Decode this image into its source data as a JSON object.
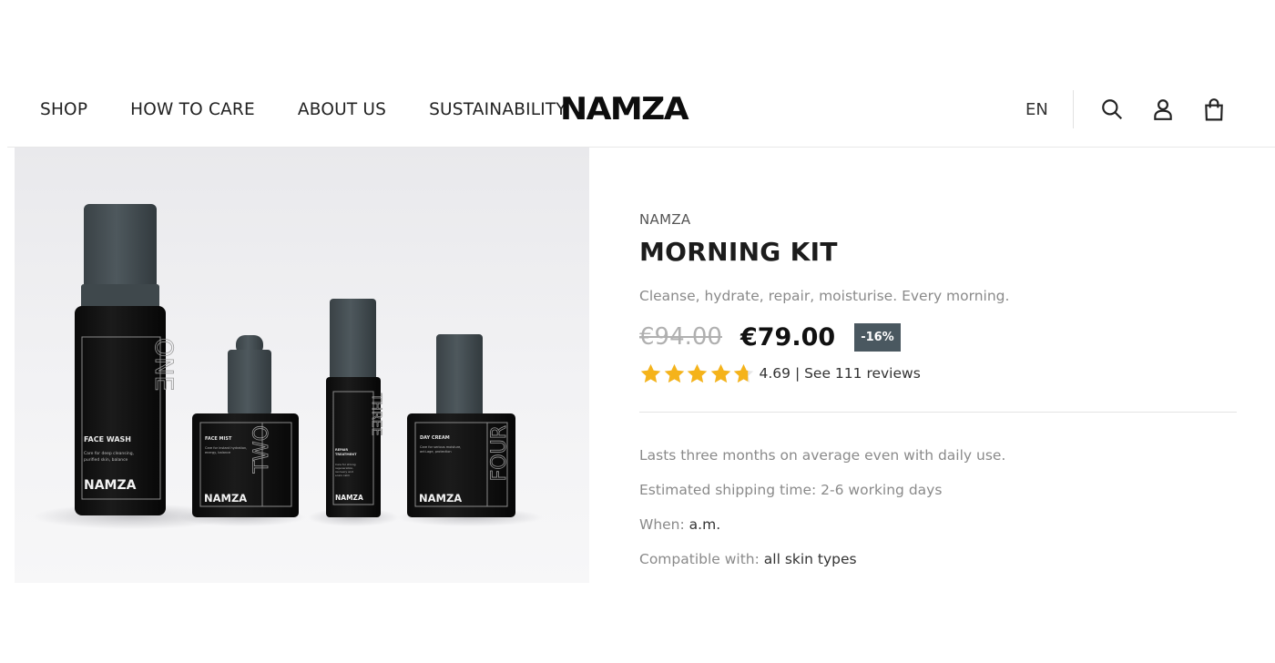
{
  "nav": {
    "items": [
      "SHOP",
      "HOW TO CARE",
      "ABOUT US",
      "SUSTAINABILITY"
    ],
    "logo": "NAMZA",
    "language": "EN",
    "icons": [
      "search-icon",
      "user-icon",
      "bag-icon"
    ]
  },
  "product": {
    "brand": "NAMZA",
    "title": "MORNING KIT",
    "tagline": "Cleanse, hydrate, repair, moisturise. Every morning.",
    "old_price": "€94.00",
    "price": "€79.00",
    "discount": "-16%",
    "rating": 4.69,
    "rating_text": "4.69 | See 111 reviews",
    "details": {
      "lasts": "Lasts three months on average even with daily use.",
      "shipping": "Estimated shipping time: 2-6 working days",
      "when_label": "When:",
      "when_value": "a.m.",
      "compatible_label": "Compatible with:",
      "compatible_value": "all skin types"
    }
  },
  "image": {
    "bottles": [
      {
        "number": "ONE",
        "name": "FACE WASH",
        "desc": "Care for deep cleansing, purified skin, balance",
        "brand": "NAMZA"
      },
      {
        "number": "TWO",
        "name": "FACE MIST",
        "desc": "Care for instant hydration, energy, balance",
        "brand": "NAMZA"
      },
      {
        "number": "THREE",
        "name": "REPAIR TREATMENT",
        "desc": "Care for strong regeneration, recovery and scars calm",
        "brand": "NAMZA"
      },
      {
        "number": "FOUR",
        "name": "DAY CREAM",
        "desc": "Care for serious moisture, anti-age, protection",
        "brand": "NAMZA"
      }
    ]
  },
  "colors": {
    "badge_bg": "#4a5860",
    "star": "#f5b31a",
    "text_muted": "#8a8a8a"
  }
}
